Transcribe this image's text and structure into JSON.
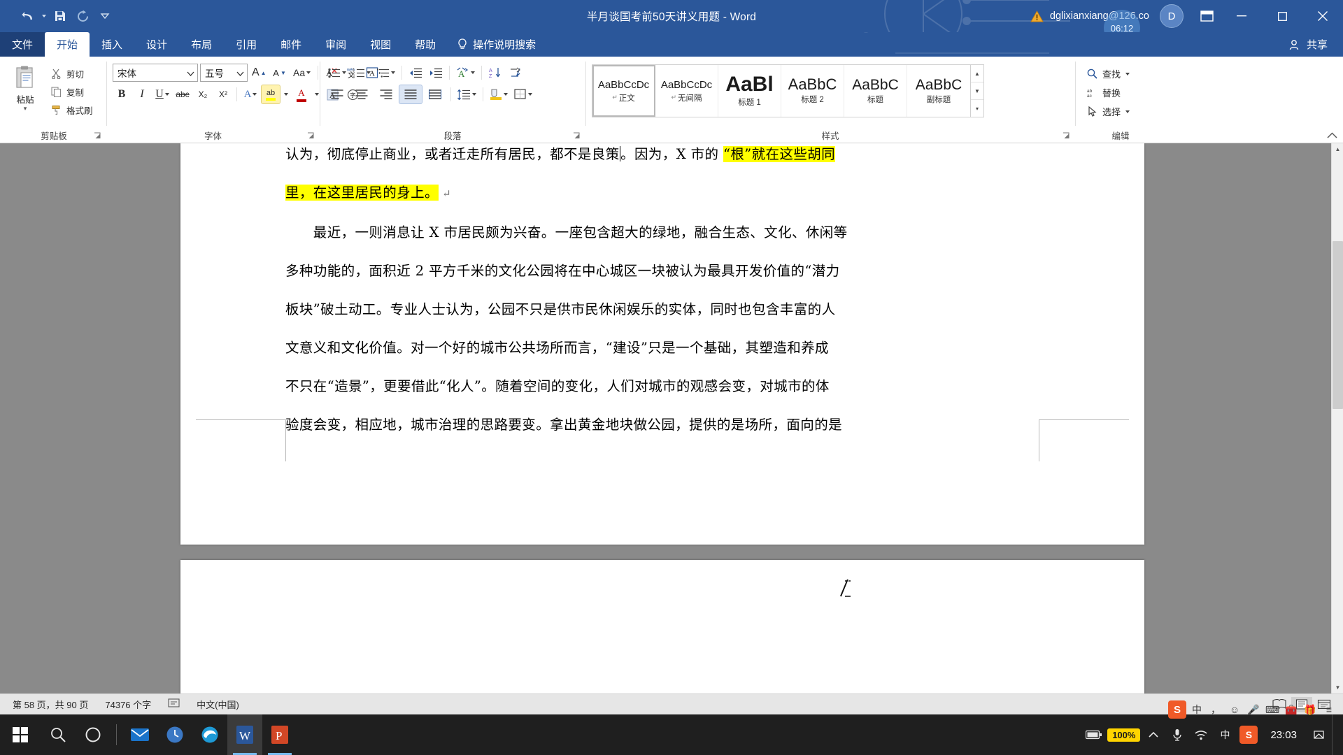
{
  "titlebar": {
    "qat": [
      {
        "name": "undo-icon",
        "label": "撤销"
      },
      {
        "name": "save-icon",
        "label": "保存"
      },
      {
        "name": "redo-icon",
        "label": "重复"
      },
      {
        "name": "customize-qat-icon",
        "label": "自定义快速访问工具栏"
      }
    ],
    "document_title": "半月谈国考前50天讲义用题  -  Word",
    "warning_icon": "warning-triangle-icon",
    "account": "dglixianxiang@126.co",
    "avatar_initial": "D",
    "clock_badge": "06:12",
    "ribbon_display_icon": "ribbon-display-options-icon",
    "minimize": "—",
    "maximize": "▢",
    "close": "✕"
  },
  "tabs": [
    {
      "label": "文件",
      "active": false,
      "file": true
    },
    {
      "label": "开始",
      "active": true,
      "file": false
    },
    {
      "label": "插入",
      "active": false,
      "file": false
    },
    {
      "label": "设计",
      "active": false,
      "file": false
    },
    {
      "label": "布局",
      "active": false,
      "file": false
    },
    {
      "label": "引用",
      "active": false,
      "file": false
    },
    {
      "label": "邮件",
      "active": false,
      "file": false
    },
    {
      "label": "审阅",
      "active": false,
      "file": false
    },
    {
      "label": "视图",
      "active": false,
      "file": false
    },
    {
      "label": "帮助",
      "active": false,
      "file": false
    }
  ],
  "tellme": {
    "icon": "lightbulb-icon",
    "label": "操作说明搜索"
  },
  "share": {
    "icon": "share-person-icon",
    "label": "共享"
  },
  "ribbon": {
    "clipboard": {
      "group_label": "剪贴板",
      "paste_label": "粘贴",
      "items": [
        {
          "label": "剪切",
          "icon": "scissors-icon"
        },
        {
          "label": "复制",
          "icon": "copy-icon"
        },
        {
          "label": "格式刷",
          "icon": "format-painter-icon"
        }
      ]
    },
    "font": {
      "group_label": "字体",
      "font_name": "宋体",
      "font_size": "五号",
      "buttons_row1": [
        {
          "name": "grow-font-button",
          "label": "A"
        },
        {
          "name": "shrink-font-button",
          "label": "A"
        },
        {
          "name": "change-case-button",
          "label": "Aa"
        },
        {
          "name": "clear-formatting-button",
          "label": "A"
        },
        {
          "name": "phonetic-guide-button",
          "label": "wén"
        },
        {
          "name": "character-border-button",
          "label": "A"
        }
      ],
      "buttons_row2": [
        {
          "name": "bold-button",
          "label": "B"
        },
        {
          "name": "italic-button",
          "label": "I"
        },
        {
          "name": "underline-button",
          "label": "U"
        },
        {
          "name": "strikethrough-button",
          "label": "abc"
        },
        {
          "name": "subscript-button",
          "label": "X₂"
        },
        {
          "name": "superscript-button",
          "label": "X²"
        },
        {
          "name": "text-effects-button",
          "label": "A"
        },
        {
          "name": "text-highlight-button",
          "label": "ab"
        },
        {
          "name": "font-color-button",
          "label": "A"
        },
        {
          "name": "character-shading-button",
          "label": "A"
        },
        {
          "name": "enclose-characters-button",
          "label": "字"
        }
      ]
    },
    "paragraph": {
      "group_label": "段落",
      "buttons_row1": [
        {
          "name": "bullets-button"
        },
        {
          "name": "numbering-button"
        },
        {
          "name": "multilevel-list-button"
        },
        {
          "name": "decrease-indent-button"
        },
        {
          "name": "increase-indent-button"
        },
        {
          "name": "asian-layout-button"
        },
        {
          "name": "sort-button"
        },
        {
          "name": "show-formatting-marks-button"
        }
      ],
      "buttons_row2": [
        {
          "name": "align-left-button"
        },
        {
          "name": "align-center-button"
        },
        {
          "name": "align-right-button"
        },
        {
          "name": "justify-button"
        },
        {
          "name": "distribute-button"
        },
        {
          "name": "line-spacing-button"
        },
        {
          "name": "shading-button"
        },
        {
          "name": "borders-button"
        }
      ]
    },
    "styles": {
      "group_label": "样式",
      "gallery": [
        {
          "sample": "AaBbCcDc",
          "name": "正文",
          "selected": true,
          "pilcrow": "↵",
          "size": "15px",
          "weight": "normal",
          "color": "#1a1a1a"
        },
        {
          "sample": "AaBbCcDc",
          "name": "无间隔",
          "selected": false,
          "pilcrow": "↵",
          "size": "15px",
          "weight": "normal",
          "color": "#1a1a1a"
        },
        {
          "sample": "AaBl",
          "name": "标题 1",
          "selected": false,
          "pilcrow": "",
          "size": "30px",
          "weight": "bold",
          "color": "#0f0f0f"
        },
        {
          "sample": "AaBbC",
          "name": "标题 2",
          "selected": false,
          "pilcrow": "",
          "size": "22px",
          "weight": "normal",
          "color": "#0f0f0f"
        },
        {
          "sample": "AaBbC",
          "name": "标题",
          "selected": false,
          "pilcrow": "",
          "size": "21px",
          "weight": "normal",
          "color": "#1a1a1a"
        },
        {
          "sample": "AaBbC",
          "name": "副标题",
          "selected": false,
          "pilcrow": "",
          "size": "21px",
          "weight": "normal",
          "color": "#1a1a1a"
        }
      ]
    },
    "editing": {
      "group_label": "编辑",
      "items": [
        {
          "label": "查找",
          "icon": "search-icon",
          "caret": true
        },
        {
          "label": "替换",
          "icon": "replace-icon",
          "caret": false
        },
        {
          "label": "选择",
          "icon": "select-icon",
          "caret": true
        }
      ]
    }
  },
  "document": {
    "lines": [
      {
        "segments": [
          {
            "text": "认为，彻底停止商业，或者迁走所有居民，都不是良策",
            "hl": false
          },
          {
            "text": "。因为，X 市的 ",
            "hl": false
          },
          {
            "text": "“根”就在这些胡同",
            "hl": true
          }
        ],
        "caret_after": 0
      },
      {
        "segments": [
          {
            "text": "里，在这里居民的身上。",
            "hl": true
          },
          {
            "text": " ↵",
            "hl": false,
            "mark": true
          }
        ]
      },
      {
        "segments": [
          {
            "text": "　　最近，一则消息让 X 市居民颇为兴奋。一座包含超大的绿地，融合生态、文化、休闲等",
            "hl": false
          }
        ]
      },
      {
        "segments": [
          {
            "text": "多种功能的，面积近 2 平方千米的文化公园将在中心城区一块被认为最具开发价值的“潜力",
            "hl": false
          }
        ]
      },
      {
        "segments": [
          {
            "text": "板块”破土动工。专业人士认为，公园不只是供市民休闲娱乐的实体，同时也包含丰富的人",
            "hl": false
          }
        ]
      },
      {
        "segments": [
          {
            "text": "文意义和文化价值。对一个好的城市公共场所而言，“建设”只是一个基础，其塑造和养成",
            "hl": false
          }
        ]
      },
      {
        "segments": [
          {
            "text": "不只在“造景”，更要借此“化人”。随着空间的变化，人们对城市的观感会变，对城市的体",
            "hl": false
          }
        ]
      },
      {
        "segments": [
          {
            "text": "验度会变，相应地，城市治理的思路要变。拿出黄金地块做公园，提供的是场所，面向的是",
            "hl": false
          }
        ]
      }
    ]
  },
  "statusbar": {
    "page": "第 58 页，共 90 页",
    "words": "74376 个字",
    "proofing_icon": "proofing-errors-icon",
    "language": "中文(中国)",
    "views": [
      {
        "name": "read-mode-button",
        "active": false
      },
      {
        "name": "print-layout-button",
        "active": true
      },
      {
        "name": "web-layout-button",
        "active": false
      }
    ]
  },
  "ime": {
    "logo": "S",
    "mode": "中",
    "punct": "，",
    "emoji": "☺",
    "voice": "🎤",
    "keyboard": "⌨",
    "toolbox": "🧰",
    "gift": "🎁",
    "menu": "≡"
  },
  "taskbar": {
    "start_icon": "windows-start-icon",
    "search_icon": "search-icon",
    "cortana_icon": "cortana-circle-icon",
    "apps": [
      {
        "name": "taskbar-mail",
        "icon": "mail-icon",
        "color": "#1a73c9",
        "running": false
      },
      {
        "name": "taskbar-clock-app",
        "icon": "clock-app-icon",
        "color": "#3b78c4",
        "running": false
      },
      {
        "name": "taskbar-edge",
        "icon": "edge-icon",
        "color": "#1e9ad6",
        "running": false
      },
      {
        "name": "taskbar-word",
        "icon": "word-icon",
        "color": "#2b579a",
        "running": true,
        "active": true
      },
      {
        "name": "taskbar-powerpoint",
        "icon": "powerpoint-icon",
        "color": "#d24726",
        "running": true,
        "active": false
      }
    ],
    "tray": {
      "battery_label": "100%",
      "clock": "23:03",
      "sogou": "S",
      "lang": "中"
    }
  }
}
